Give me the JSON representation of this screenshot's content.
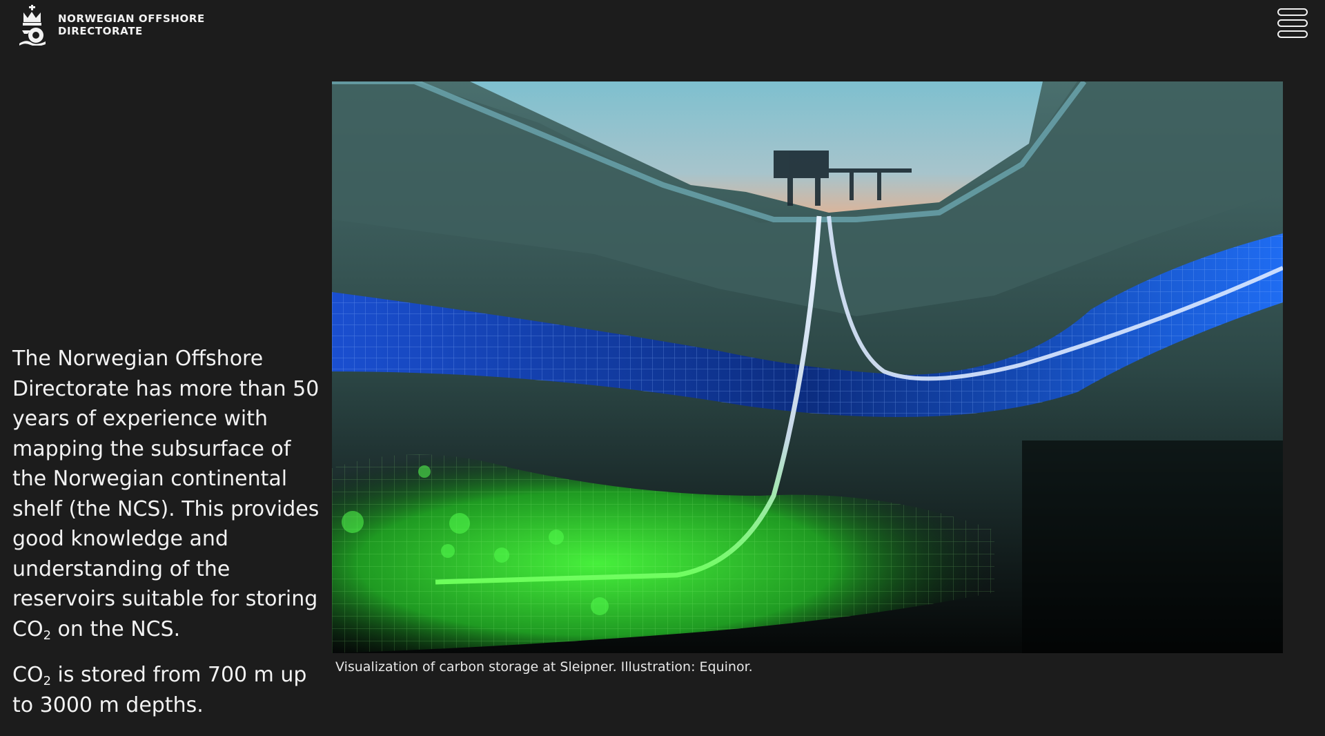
{
  "header": {
    "logo_line1": "NORWEGIAN OFFSHORE",
    "logo_line2": "DIRECTORATE",
    "menu_icon": "hamburger-menu-icon"
  },
  "intro": {
    "p1_before": "The Norwegian Offshore Directorate has more than 50 years of experience with mapping the subsurface of the Norwegian continental shelf (the NCS). This provides good knowledge and understanding of the reservoirs suitable for storing CO",
    "p1_sub": "2",
    "p1_after": " on the NCS.",
    "p2_before": "CO",
    "p2_sub": "2",
    "p2_after": " is stored from 700 m up to 3000 m depths."
  },
  "figure": {
    "caption": "Visualization of carbon storage at Sleipner. Illustration: Equinor."
  },
  "colors": {
    "background": "#1c1c1c",
    "text": "#f2f2f2",
    "storage_blue": "#1f5be6",
    "storage_green": "#35e83a"
  }
}
